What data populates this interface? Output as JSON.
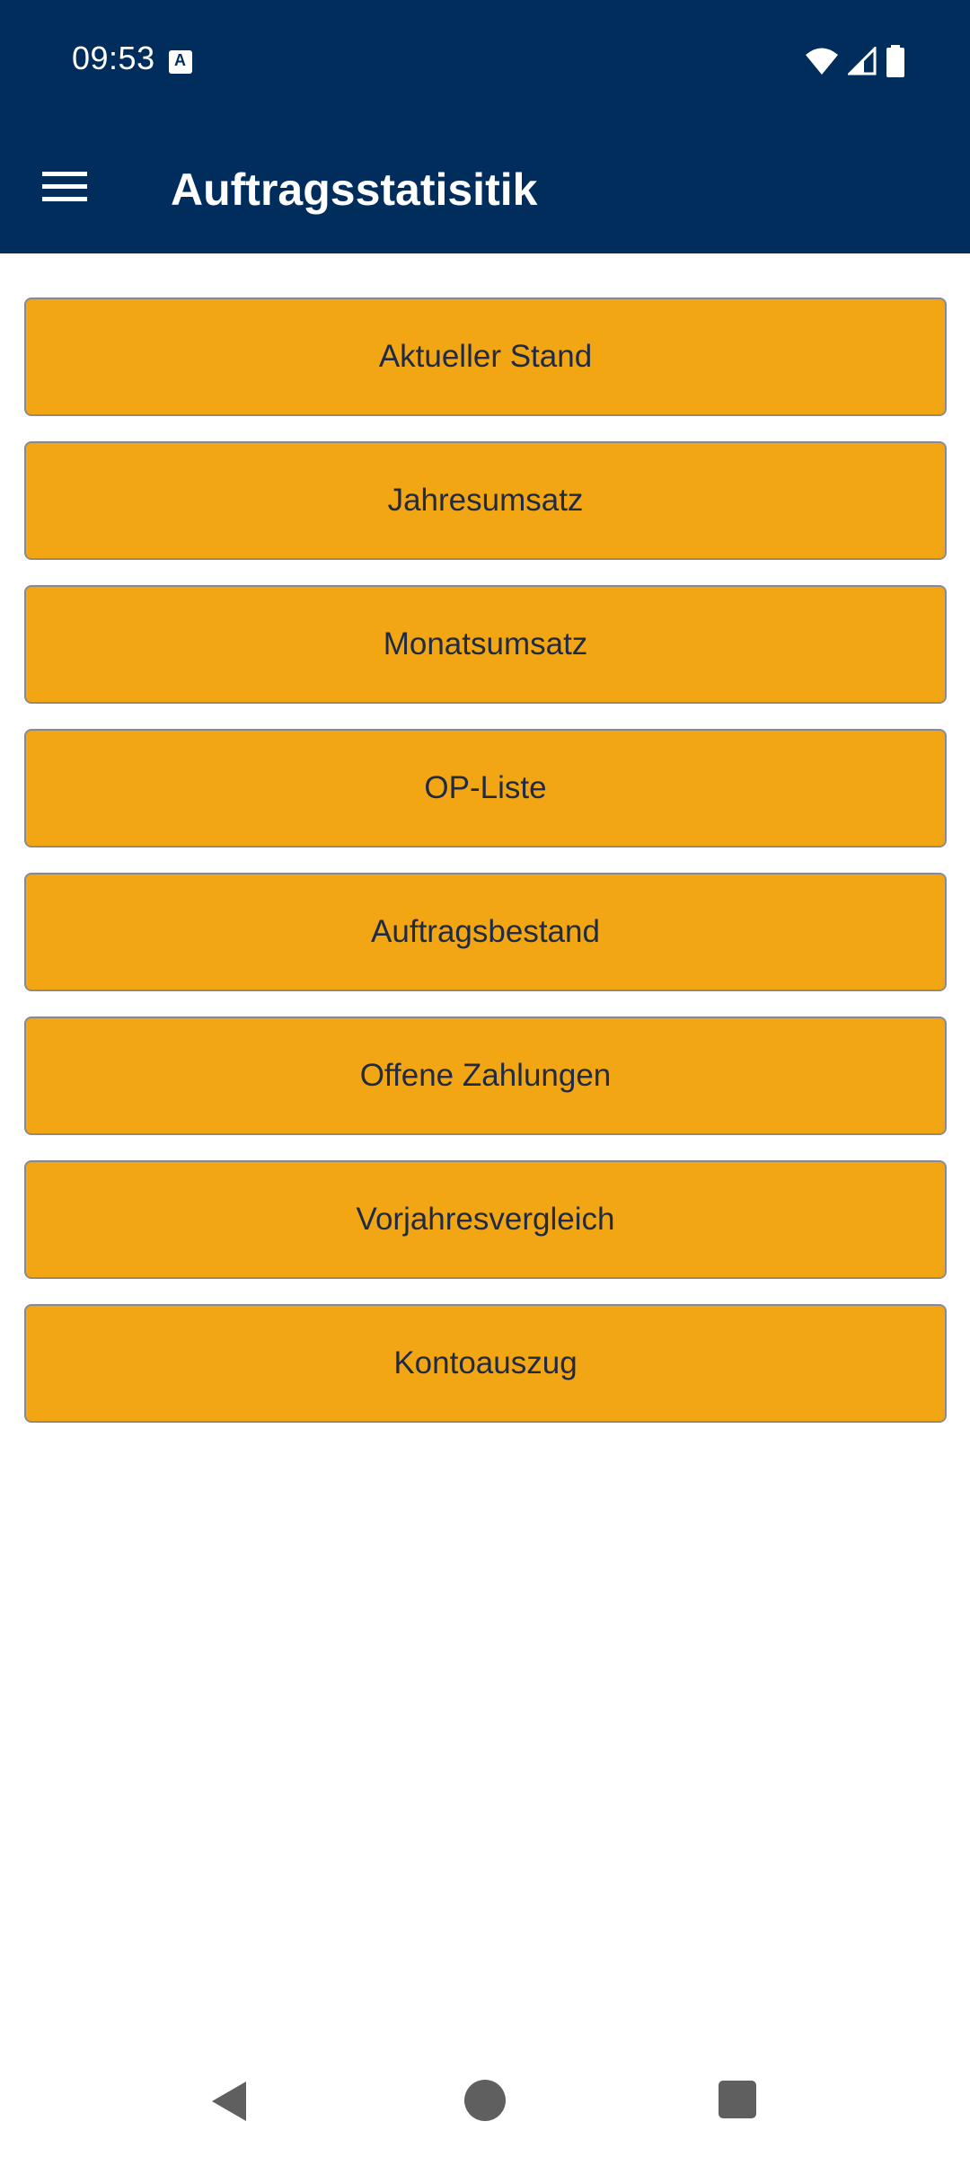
{
  "status_bar": {
    "time": "09:53",
    "notification_icon": "accessibility-notification-icon",
    "icons": [
      "wifi-icon",
      "signal-icon",
      "battery-icon"
    ]
  },
  "app_bar": {
    "menu_icon": "hamburger-menu-icon",
    "title": "Auftragsstatisitik",
    "background_color": "#002d5c"
  },
  "buttons": [
    {
      "label": "Aktueller Stand"
    },
    {
      "label": "Jahresumsatz"
    },
    {
      "label": "Monatsumsatz"
    },
    {
      "label": "OP-Liste"
    },
    {
      "label": "Auftragsbestand"
    },
    {
      "label": "Offene Zahlungen"
    },
    {
      "label": "Vorjahresvergleich"
    },
    {
      "label": "Kontoauszug"
    }
  ],
  "colors": {
    "accent": "#f3a614",
    "button_text": "#1f2a44",
    "page_background": "#ffffff"
  },
  "nav_bar": {
    "icons": [
      "back-icon",
      "home-icon",
      "recents-icon"
    ]
  }
}
